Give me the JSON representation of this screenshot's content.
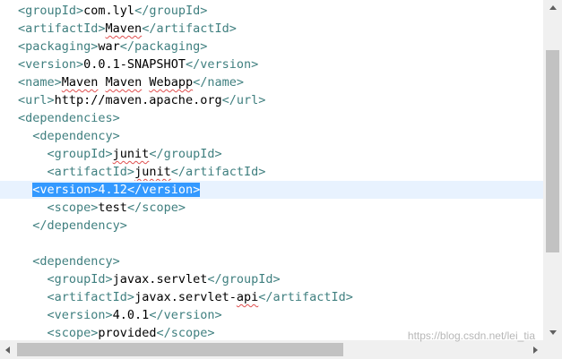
{
  "editor": {
    "lines": [
      {
        "indent": "",
        "tokens": [
          [
            "tag",
            "<groupId>"
          ],
          [
            "txt",
            "com.lyl"
          ],
          [
            "tag",
            "</groupId>"
          ]
        ]
      },
      {
        "indent": "",
        "tokens": [
          [
            "tag",
            "<artifactId>"
          ],
          [
            "sp",
            "Maven"
          ],
          [
            "tag",
            "</artifactId>"
          ]
        ]
      },
      {
        "indent": "",
        "tokens": [
          [
            "tag",
            "<packaging>"
          ],
          [
            "txt",
            "war"
          ],
          [
            "tag",
            "</packaging>"
          ]
        ]
      },
      {
        "indent": "",
        "tokens": [
          [
            "tag",
            "<version>"
          ],
          [
            "txt",
            "0.0.1-SNAPSHOT"
          ],
          [
            "tag",
            "</version>"
          ]
        ]
      },
      {
        "indent": "",
        "tokens": [
          [
            "tag",
            "<name>"
          ],
          [
            "sp",
            "Maven"
          ],
          [
            "txt",
            " "
          ],
          [
            "sp",
            "Maven"
          ],
          [
            "txt",
            " "
          ],
          [
            "sp",
            "Webapp"
          ],
          [
            "tag",
            "</name>"
          ]
        ]
      },
      {
        "indent": "",
        "tokens": [
          [
            "tag",
            "<url>"
          ],
          [
            "txt",
            "http://maven.apache.org"
          ],
          [
            "tag",
            "</url>"
          ]
        ]
      },
      {
        "indent": "",
        "tokens": [
          [
            "tag",
            "<dependencies>"
          ]
        ]
      },
      {
        "indent": "  ",
        "tokens": [
          [
            "tag",
            "<dependency>"
          ]
        ]
      },
      {
        "indent": "    ",
        "tokens": [
          [
            "tag",
            "<groupId>"
          ],
          [
            "sp",
            "junit"
          ],
          [
            "tag",
            "</groupId>"
          ]
        ]
      },
      {
        "indent": "    ",
        "tokens": [
          [
            "tag",
            "<artifactId>"
          ],
          [
            "sp",
            "junit"
          ],
          [
            "tag",
            "</artifactId>"
          ]
        ]
      },
      {
        "indent": "  ",
        "current": true,
        "selected": true,
        "tokens": [
          [
            "tag",
            "<version>"
          ],
          [
            "txt",
            "4.12"
          ],
          [
            "tag",
            "</version>"
          ]
        ]
      },
      {
        "indent": "    ",
        "tokens": [
          [
            "tag",
            "<scope>"
          ],
          [
            "txt",
            "test"
          ],
          [
            "tag",
            "</scope>"
          ]
        ]
      },
      {
        "indent": "  ",
        "tokens": [
          [
            "tag",
            "</dependency>"
          ]
        ]
      },
      {
        "indent": "",
        "tokens": []
      },
      {
        "indent": "  ",
        "tokens": [
          [
            "tag",
            "<dependency>"
          ]
        ]
      },
      {
        "indent": "    ",
        "tokens": [
          [
            "tag",
            "<groupId>"
          ],
          [
            "txt",
            "javax.servlet"
          ],
          [
            "tag",
            "</groupId>"
          ]
        ]
      },
      {
        "indent": "    ",
        "tokens": [
          [
            "tag",
            "<artifactId>"
          ],
          [
            "txt",
            "javax.servlet-"
          ],
          [
            "sp",
            "api"
          ],
          [
            "tag",
            "</artifactId>"
          ]
        ]
      },
      {
        "indent": "    ",
        "tokens": [
          [
            "tag",
            "<version>"
          ],
          [
            "txt",
            "4.0.1"
          ],
          [
            "tag",
            "</version>"
          ]
        ]
      },
      {
        "indent": "    ",
        "tokens": [
          [
            "tag",
            "<scope>"
          ],
          [
            "txt",
            "provided"
          ],
          [
            "tag",
            "</scope>"
          ]
        ]
      }
    ]
  },
  "icons": {
    "scroll_up": "triangle-up",
    "scroll_down": "triangle-down",
    "scroll_left": "triangle-left",
    "scroll_right": "triangle-right"
  },
  "watermark": "https://blog.csdn.net/lei_tia",
  "colors": {
    "tag": "#3f7f7f",
    "text": "#000000",
    "selection": "#3399ff",
    "current_line": "#e8f2fe",
    "spell_underline": "#e05050"
  }
}
